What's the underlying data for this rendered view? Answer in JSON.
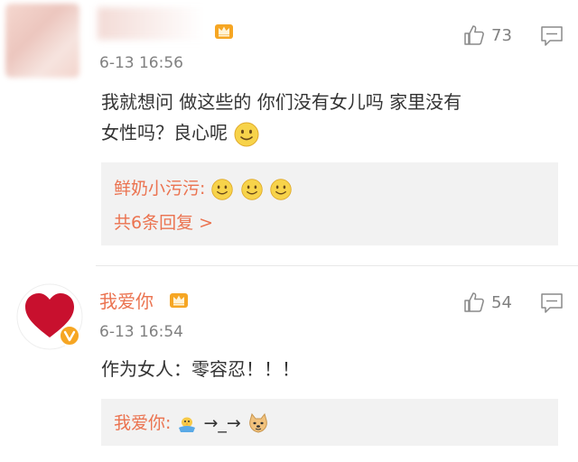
{
  "comments": [
    {
      "username": "",
      "time": "6-13 16:56",
      "text_line1": "我就想问 做这些的 你们没有女儿吗 家里没有",
      "text_line2": "女性吗？良心呢",
      "likes": "73",
      "avatar_icon": "blurred-avatar",
      "badge_icon": "crown-icon",
      "reply_preview": {
        "user": "鲜奶小污污:",
        "emojis": [
          "smile-emoji",
          "smile-emoji",
          "smile-emoji"
        ],
        "more": "共6条回复 >"
      }
    },
    {
      "username": "我爱你",
      "time": "6-13 16:54",
      "text": "作为女人：零容忍！！！",
      "likes": "54",
      "avatar_icon": "heart-icon",
      "badge_icon": "crown-icon",
      "reply_preview": {
        "user": "我爱你:",
        "arrow1": "→",
        "underscore": "_",
        "arrow2": "→"
      }
    }
  ],
  "colors": {
    "accent": "#eb7350",
    "muted": "#808080",
    "reply_bg": "#f2f2f2",
    "heart": "#c8102e"
  }
}
